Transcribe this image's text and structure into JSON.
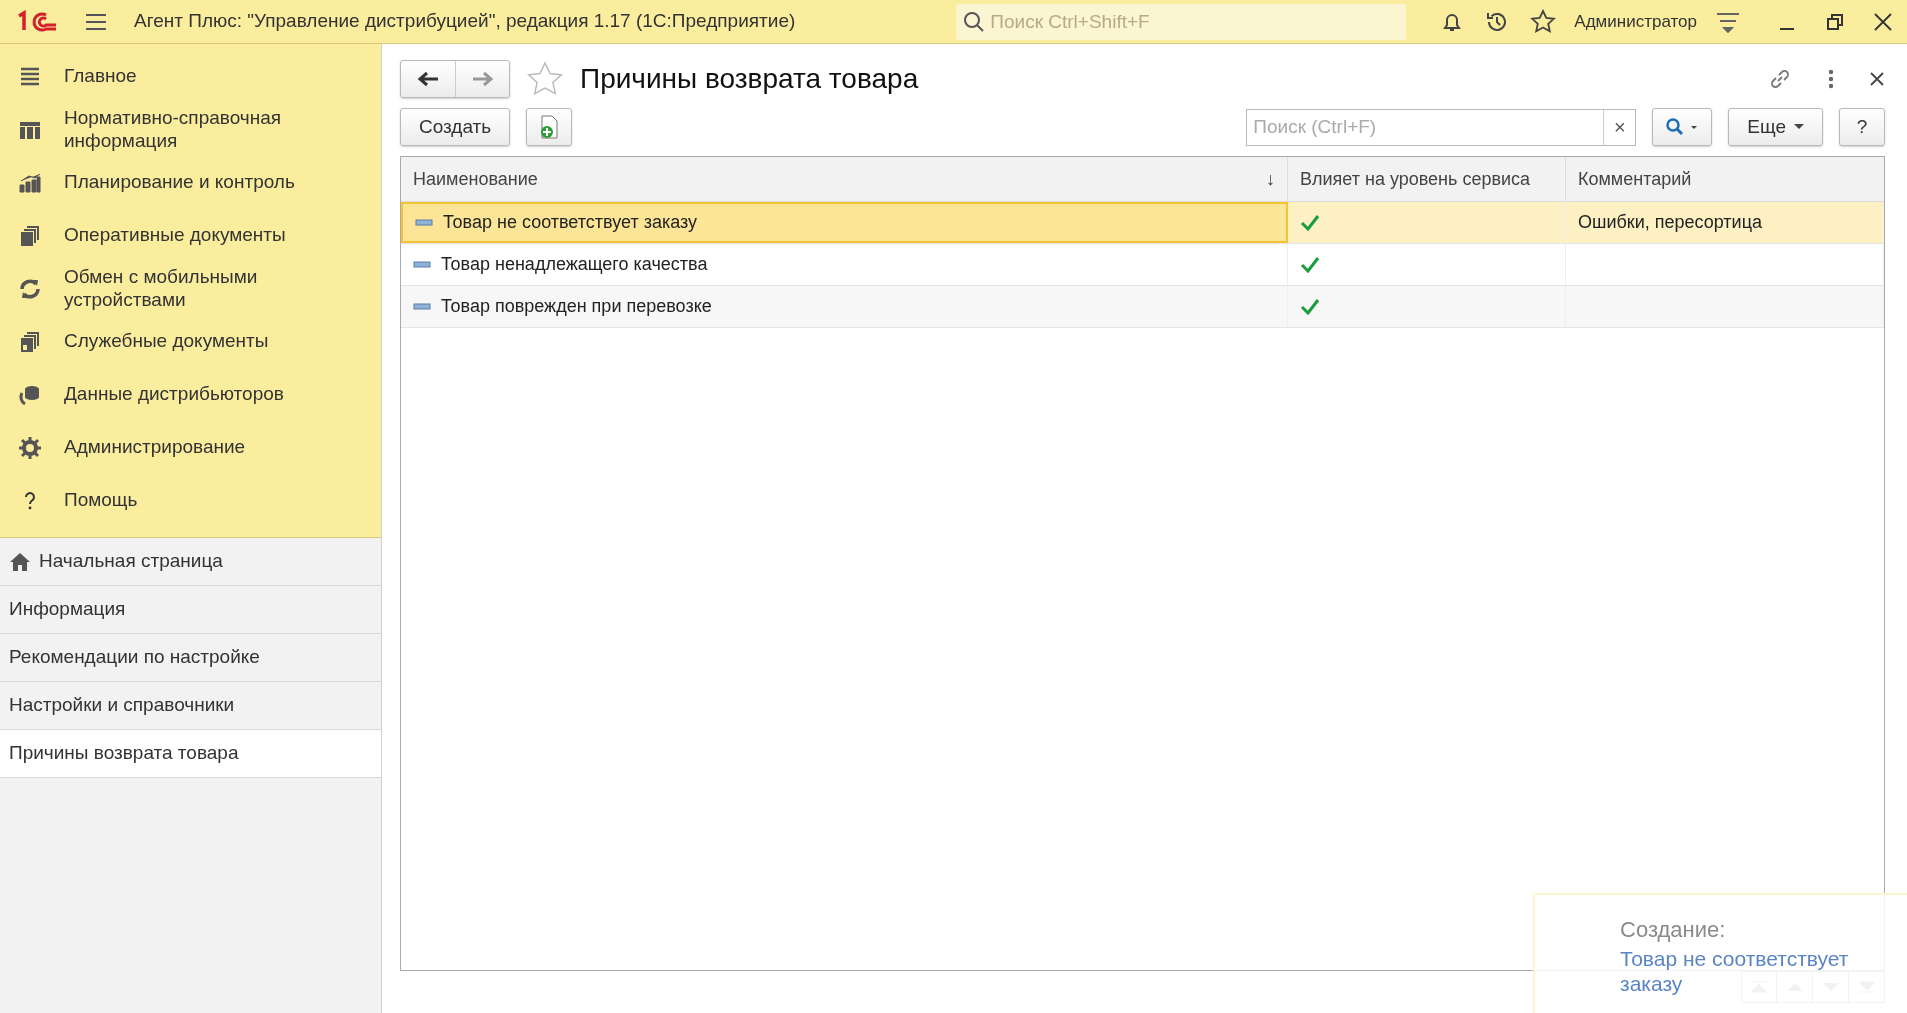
{
  "app_bar": {
    "title": "Агент Плюс: \"Управление дистрибуцией\", редакция 1.17  (1С:Предприятие)",
    "search": {
      "placeholder": "Поиск Ctrl+Shift+F"
    },
    "user": "Администратор"
  },
  "sidebar": {
    "sections": [
      {
        "label": "Главное",
        "kind": "menu"
      },
      {
        "label": "Нормативно-справочная информация",
        "kind": "grid"
      },
      {
        "label": "Планирование и контроль",
        "kind": "chart"
      },
      {
        "label": "Оперативные документы",
        "kind": "docs"
      },
      {
        "label": "Обмен с мобильными устройствами",
        "kind": "sync"
      },
      {
        "label": "Служебные документы",
        "kind": "docs2"
      },
      {
        "label": "Данные дистрибьюторов",
        "kind": "db"
      },
      {
        "label": "Администрирование",
        "kind": "gear"
      },
      {
        "label": "Помощь",
        "kind": "help"
      }
    ],
    "open_windows": [
      {
        "label": "Начальная страница",
        "home": true,
        "selected": false
      },
      {
        "label": "Информация",
        "home": false,
        "selected": false
      },
      {
        "label": "Рекомендации по настройке",
        "home": false,
        "selected": false
      },
      {
        "label": "Настройки и справочники",
        "home": false,
        "selected": false
      },
      {
        "label": "Причины возврата товара",
        "home": false,
        "selected": true
      }
    ]
  },
  "form": {
    "title": "Причины возврата товара",
    "create_button": "Создать",
    "search": {
      "placeholder": "Поиск (Ctrl+F)"
    },
    "clear": "×",
    "more_button": "Еще",
    "help_button": "?",
    "table": {
      "columns": [
        {
          "label": "Наименование",
          "sort": "↓"
        },
        {
          "label": "Влияет на уровень сервиса"
        },
        {
          "label": "Комментарий"
        }
      ],
      "rows": [
        {
          "name": "Товар не соответствует заказу",
          "affects_service": true,
          "comment": "Ошибки, пересортица",
          "selected": true
        },
        {
          "name": "Товар ненадлежащего качества",
          "affects_service": true,
          "selected": false
        },
        {
          "name": "Товар поврежден при перевозке",
          "affects_service": true,
          "selected": false
        }
      ]
    }
  },
  "notification": {
    "title": "Создание:",
    "link": "Товар не соответствует заказу"
  }
}
